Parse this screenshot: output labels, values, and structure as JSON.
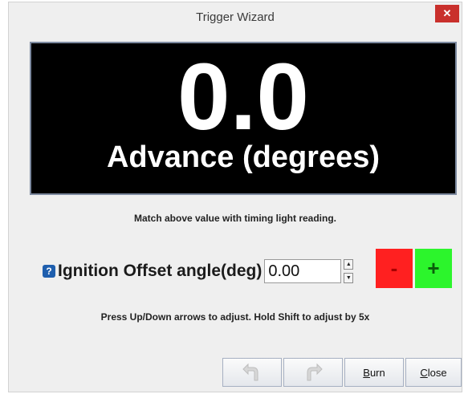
{
  "window": {
    "title": "Trigger Wizard",
    "close_glyph": "✕"
  },
  "display": {
    "value": "0.0",
    "label": "Advance (degrees)"
  },
  "instructions": {
    "match": "Match above value with timing light reading.",
    "adjust": "Press Up/Down arrows to adjust. Hold Shift to adjust by 5x"
  },
  "offset": {
    "help_glyph": "?",
    "label": "Ignition Offset angle(deg)",
    "value": "0.00",
    "spin_up": "▲",
    "spin_down": "▼",
    "minus_label": "-",
    "plus_label": "+"
  },
  "buttons": {
    "undo_icon": "undo-icon",
    "redo_icon": "redo-icon",
    "burn_first": "B",
    "burn_rest": "urn",
    "close_first": "C",
    "close_rest": "lose"
  },
  "colors": {
    "minus_bg": "#ff2020",
    "plus_bg": "#2cf52c",
    "display_bg": "#000000",
    "close_bg": "#c9302c"
  }
}
